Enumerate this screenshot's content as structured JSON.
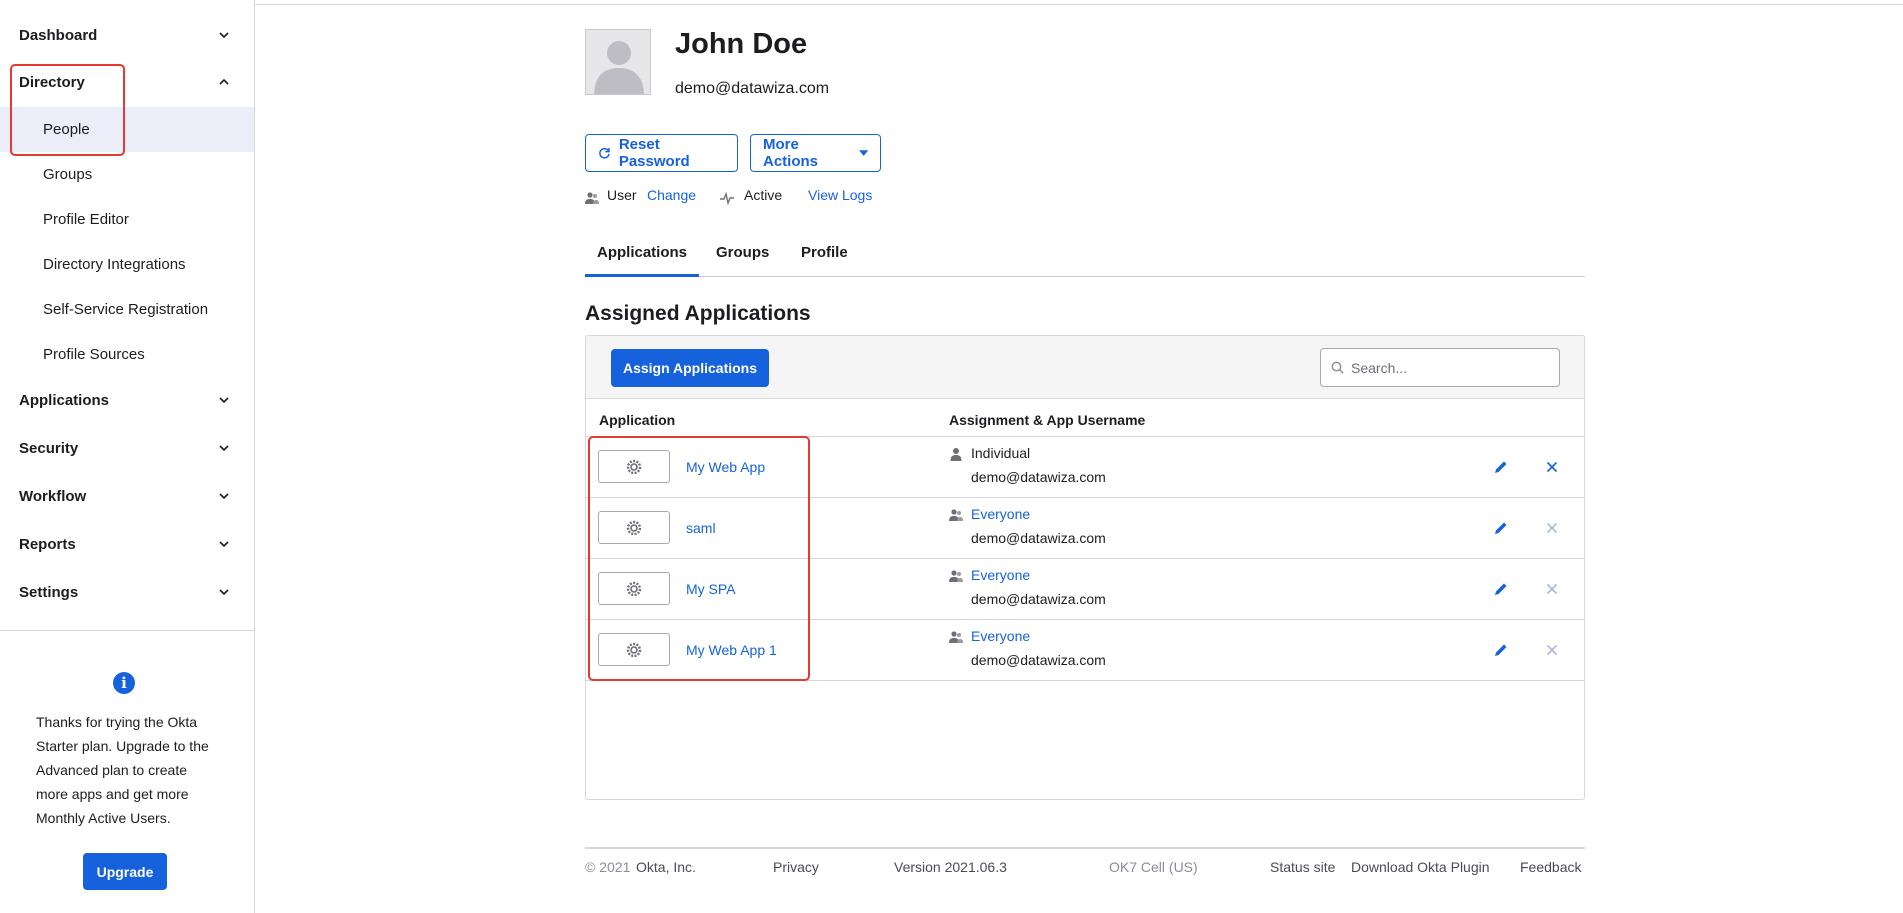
{
  "sidebar": {
    "sections": [
      {
        "label": "Dashboard",
        "expanded": false
      },
      {
        "label": "Directory",
        "expanded": true
      },
      {
        "label": "Applications",
        "expanded": false
      },
      {
        "label": "Security",
        "expanded": false
      },
      {
        "label": "Workflow",
        "expanded": false
      },
      {
        "label": "Reports",
        "expanded": false
      },
      {
        "label": "Settings",
        "expanded": false
      }
    ],
    "directory_items": [
      {
        "label": "People",
        "active": true
      },
      {
        "label": "Groups"
      },
      {
        "label": "Profile Editor"
      },
      {
        "label": "Directory Integrations"
      },
      {
        "label": "Self-Service Registration"
      },
      {
        "label": "Profile Sources"
      }
    ],
    "promo": {
      "icon": "info-icon",
      "text": "Thanks for trying the Okta Starter plan. Upgrade to the Advanced plan to create more apps and get more Monthly Active Users.",
      "upgrade_label": "Upgrade"
    }
  },
  "user": {
    "name": "John Doe",
    "email": "demo@datawiza.com",
    "type_label": "User",
    "change_label": "Change",
    "status_label": "Active",
    "view_logs_label": "View Logs"
  },
  "actions": {
    "reset_password_label": "Reset Password",
    "more_actions_label": "More Actions"
  },
  "tabs": [
    {
      "label": "Applications",
      "active": true
    },
    {
      "label": "Groups"
    },
    {
      "label": "Profile"
    }
  ],
  "assigned": {
    "title": "Assigned Applications",
    "assign_button_label": "Assign Applications",
    "search_placeholder": "Search...",
    "columns": [
      "Application",
      "Assignment & App Username"
    ],
    "rows": [
      {
        "app": "My Web App",
        "assignment": "Individual",
        "assignment_is_link": false,
        "username": "demo@datawiza.com",
        "delete_enabled": true
      },
      {
        "app": "saml",
        "assignment": "Everyone",
        "assignment_is_link": true,
        "username": "demo@datawiza.com",
        "delete_enabled": false
      },
      {
        "app": "My SPA",
        "assignment": "Everyone",
        "assignment_is_link": true,
        "username": "demo@datawiza.com",
        "delete_enabled": false
      },
      {
        "app": "My Web App 1",
        "assignment": "Everyone",
        "assignment_is_link": true,
        "username": "demo@datawiza.com",
        "delete_enabled": false
      }
    ]
  },
  "footer": {
    "copyright": "© 2021",
    "company": "Okta, Inc.",
    "privacy": "Privacy",
    "version": "Version 2021.06.3",
    "cell": "OK7 Cell (US)",
    "status_site": "Status site",
    "download_plugin": "Download Okta Plugin",
    "feedback": "Feedback"
  },
  "colors": {
    "accent": "#1662dd",
    "highlight": "#e53935",
    "active_nav_bg": "#ebedf9"
  }
}
